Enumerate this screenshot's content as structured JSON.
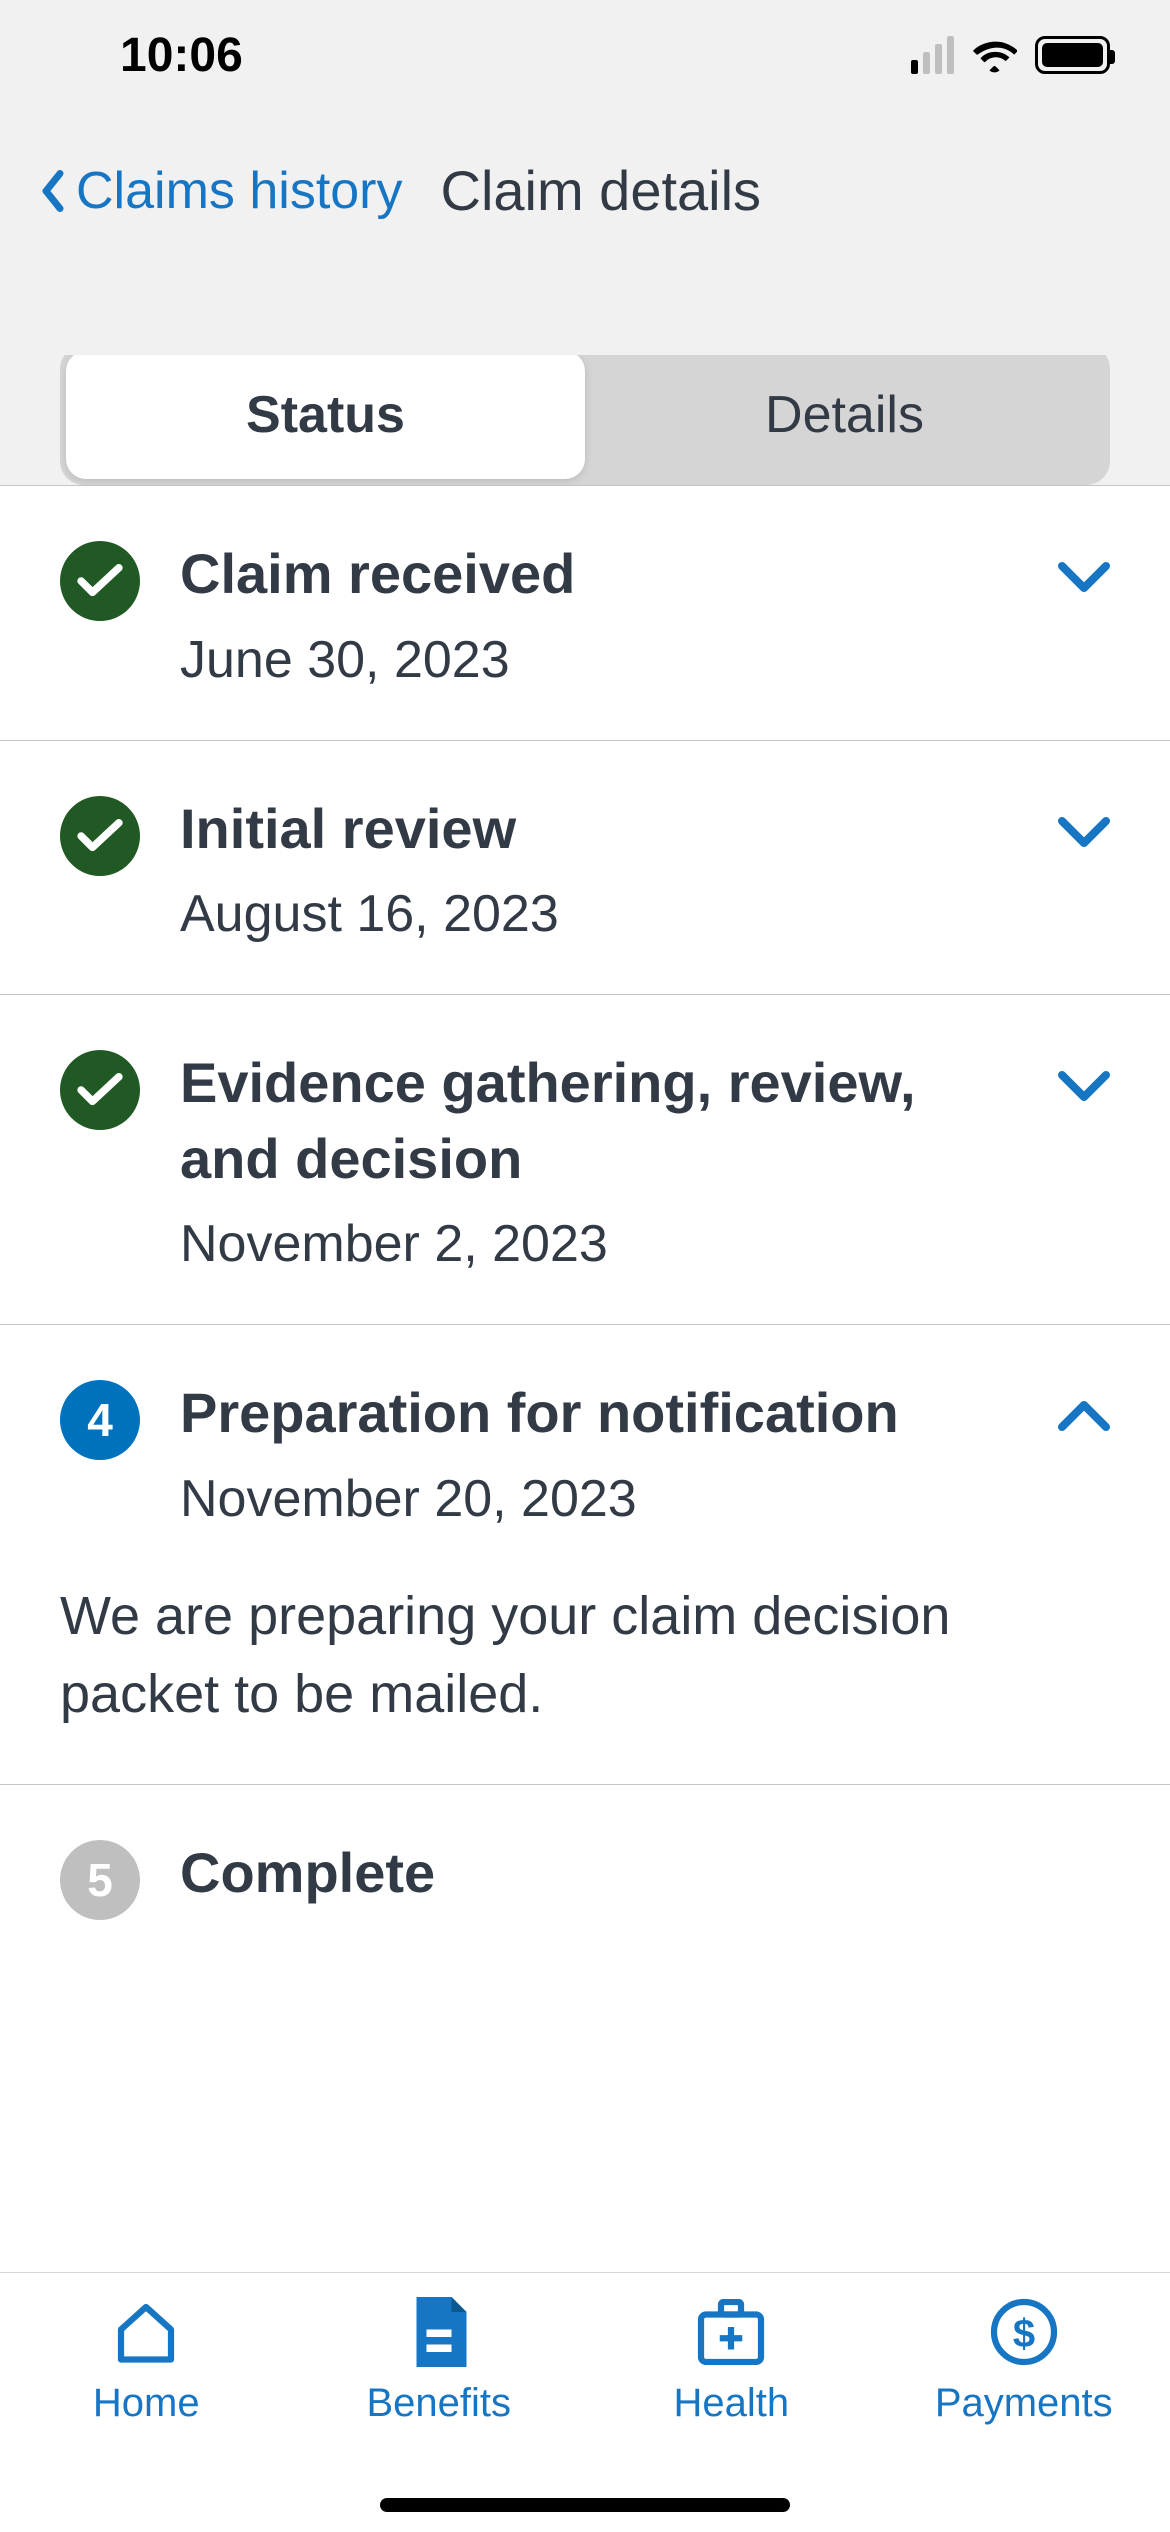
{
  "status_bar": {
    "time": "10:06"
  },
  "nav": {
    "back_label": "Claims history",
    "title": "Claim details"
  },
  "tabs": {
    "status_label": "Status",
    "details_label": "Details",
    "active": "status"
  },
  "steps": [
    {
      "title": "Claim received",
      "date": "June 30, 2023",
      "state": "done",
      "expanded": false
    },
    {
      "title": "Initial review",
      "date": "August 16, 2023",
      "state": "done",
      "expanded": false
    },
    {
      "title": "Evidence gathering, review, and decision",
      "date": "November 2, 2023",
      "state": "done",
      "expanded": false
    },
    {
      "title": "Preparation for notification",
      "date": "November 20, 2023",
      "state": "current",
      "number": "4",
      "expanded": true,
      "body": "We are preparing your claim decision packet to be mailed."
    },
    {
      "title": "Complete",
      "date": "",
      "state": "pending",
      "number": "5",
      "expanded": false
    }
  ],
  "bottom_nav": {
    "items": [
      {
        "label": "Home",
        "icon": "home"
      },
      {
        "label": "Benefits",
        "icon": "document"
      },
      {
        "label": "Health",
        "icon": "medkit"
      },
      {
        "label": "Payments",
        "icon": "dollar"
      }
    ]
  }
}
